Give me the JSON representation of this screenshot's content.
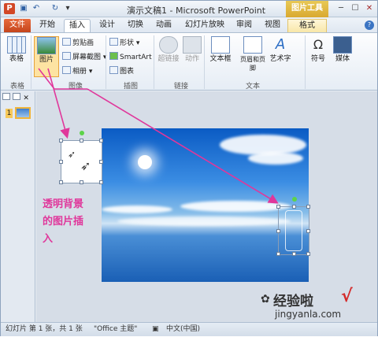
{
  "window": {
    "title": "演示文稿1 - Microsoft PowerPoint",
    "context_tab_header": "图片工具"
  },
  "quick_access": {
    "app_icon": "P",
    "save": "▣",
    "undo": "↶",
    "redo": "↻",
    "more": "▾"
  },
  "window_controls": {
    "minimize": "─",
    "maximize": "☐",
    "close": "✕"
  },
  "tabs": [
    {
      "label": "文件"
    },
    {
      "label": "开始"
    },
    {
      "label": "插入"
    },
    {
      "label": "设计"
    },
    {
      "label": "切换"
    },
    {
      "label": "动画"
    },
    {
      "label": "幻灯片放映"
    },
    {
      "label": "审阅"
    },
    {
      "label": "视图"
    },
    {
      "label": "格式"
    }
  ],
  "ribbon": {
    "table": "表格",
    "picture": "图片",
    "clipart": "剪贴画",
    "screenshot": "屏幕截图",
    "album": "相册",
    "shapes": "形状",
    "smartart": "SmartArt",
    "chart": "图表",
    "hyperlink": "超链接",
    "action": "动作",
    "textbox": "文本框",
    "header_footer": "页眉和页脚",
    "wordart": "艺术字",
    "symbol": "符号",
    "media": "媒体",
    "groups": {
      "table": "表格",
      "images": "图像",
      "illustrations": "插图",
      "links": "链接",
      "text": "文本"
    }
  },
  "pane": {
    "slide_number": "1",
    "close": "✕"
  },
  "annotation": [
    "透明背景",
    "的图片插",
    "入"
  ],
  "status": {
    "slide_info": "幻灯片 第 1 张，共 1 张",
    "theme": "\"Office 主题\"",
    "language": "中文(中国)"
  },
  "watermark": {
    "brand": "经验啦",
    "url": "jingyanla.com",
    "check": "√"
  },
  "colors": {
    "accent_pink": "#e0379b",
    "file_tab": "#d24726",
    "context_tab": "#e0b840"
  }
}
